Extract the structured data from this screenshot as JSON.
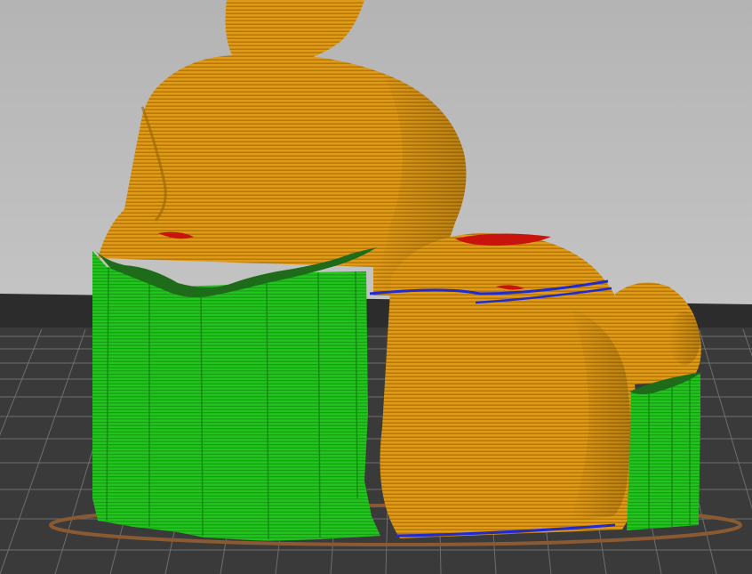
{
  "viewport": {
    "colors": {
      "background_top": "#b4b4b4",
      "background_bottom": "#d2d2d2",
      "bed": "#3a3a3a",
      "bed_grid": "#6e6e6e",
      "bed_edge": "#2c2c2c",
      "perimeter": "#e8a21c",
      "perimeter_dark": "#8a5a06",
      "support": "#22c41e",
      "support_dark": "#0f7a0c",
      "support_interface": "#1e6b1a",
      "overhang": "#c8140c",
      "bridge": "#1f2ad0",
      "skirt": "#8a5a32"
    },
    "legend_features": [
      "perimeter",
      "support",
      "support-interface",
      "overhang-perimeter",
      "bridge-infill",
      "skirt"
    ]
  }
}
